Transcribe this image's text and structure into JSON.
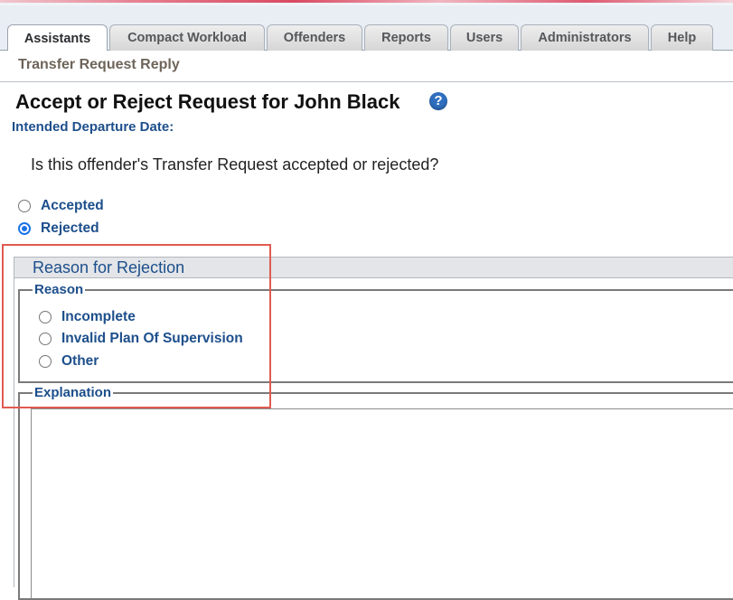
{
  "tabs": [
    {
      "label": "Assistants",
      "active": true
    },
    {
      "label": "Compact Workload",
      "active": false
    },
    {
      "label": "Offenders",
      "active": false
    },
    {
      "label": "Reports",
      "active": false
    },
    {
      "label": "Users",
      "active": false
    },
    {
      "label": "Administrators",
      "active": false
    },
    {
      "label": "Help",
      "active": false
    }
  ],
  "subnav": {
    "label": "Transfer Request Reply"
  },
  "page": {
    "title": "Accept or Reject Request for John Black",
    "help_icon": "?",
    "departure_label": "Intended Departure Date:",
    "question": "Is this offender's Transfer Request accepted or rejected?"
  },
  "decision": {
    "options": [
      {
        "label": "Accepted",
        "checked": false
      },
      {
        "label": "Rejected",
        "checked": true
      }
    ]
  },
  "rejection": {
    "header": "Reason for Rejection",
    "reason_legend": "Reason",
    "reasons": [
      {
        "label": "Incomplete",
        "checked": false
      },
      {
        "label": "Invalid Plan Of Supervision",
        "checked": false
      },
      {
        "label": "Other",
        "checked": false
      }
    ],
    "explanation_legend": "Explanation",
    "explanation_value": ""
  },
  "colors": {
    "accent_blue": "#1d4f8c",
    "highlight_red": "#e05a50",
    "radio_checked": "#1a73e8"
  }
}
